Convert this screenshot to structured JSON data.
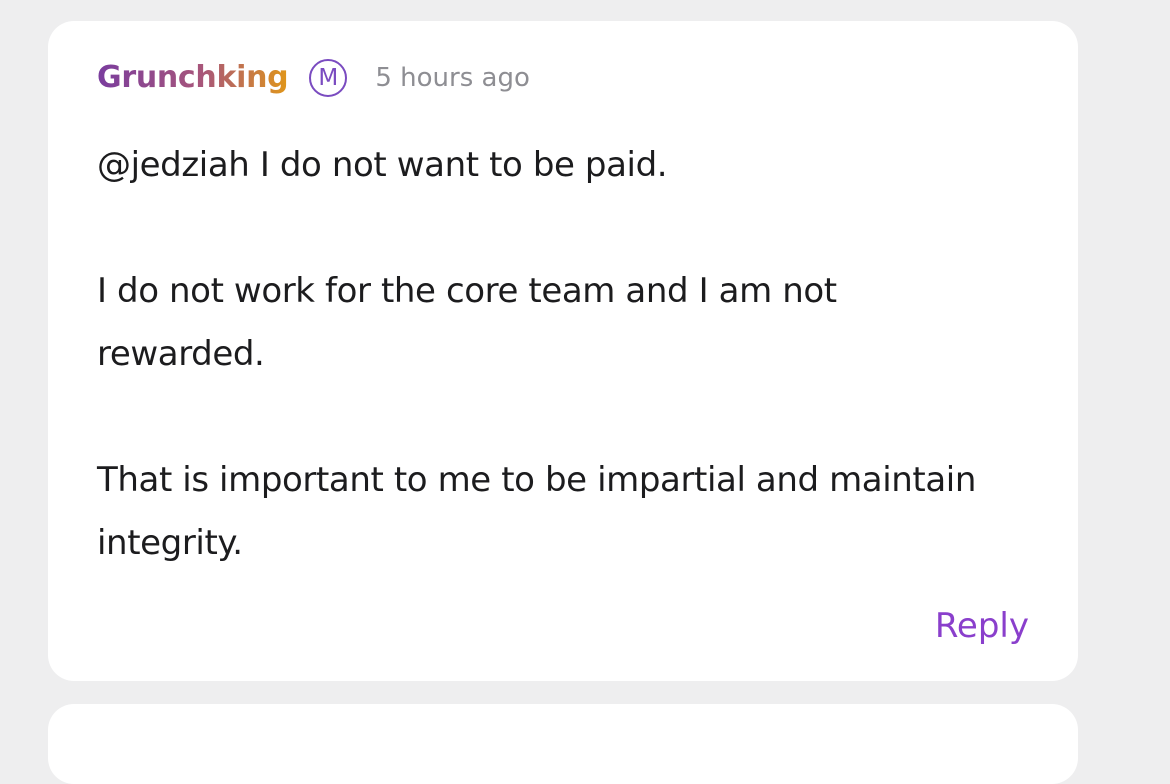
{
  "comment": {
    "author": "Grunchking",
    "badge": "M",
    "timestamp": "5 hours ago",
    "paragraphs": [
      "@jedziah I do not want to be paid.",
      "I do not work for the core team and I am not rewarded.",
      "That is important to me to be impartial and maintain integrity."
    ],
    "reply_label": "Reply"
  },
  "colors": {
    "author_gradient_start": "#7a3d9e",
    "author_gradient_end": "#e0961a",
    "badge": "#7a4bc0",
    "timestamp": "#8e8e93",
    "reply": "#8a3fcc",
    "background": "#eeeeef",
    "card": "#ffffff"
  },
  "icons": {
    "badge": "moderator-badge-icon"
  }
}
